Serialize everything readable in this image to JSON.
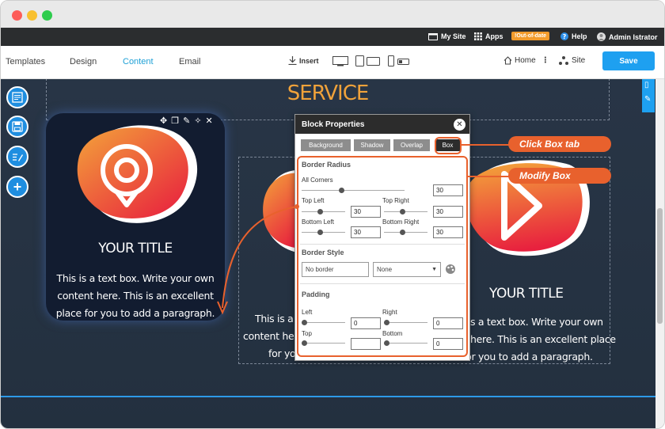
{
  "adminbar": {
    "my_site": "My Site",
    "apps": "Apps",
    "badge": "!Out-of-date",
    "help": "Help",
    "user": "Admin Istrator"
  },
  "toolbar": {
    "tabs": [
      "Templates",
      "Design",
      "Content",
      "Email"
    ],
    "active_tab": "Content",
    "insert": "Insert",
    "home": "Home",
    "site": "Site",
    "save": "Save"
  },
  "page": {
    "service_title": "SERVICE",
    "card_title": "YOUR TITLE",
    "card_text": "This is a text box. Write your own content here. This is an excellent place for you to add a paragraph.",
    "mid_text_lines": [
      "This is a t",
      "content her",
      "for yo"
    ],
    "right_title": "YOUR TITLE",
    "right_text_lines": [
      "s a text box. Write your own",
      "here. This is an excellent place",
      "for you to add a paragraph."
    ]
  },
  "panel": {
    "title": "Block Properties",
    "tabs": [
      "Background",
      "Shadow",
      "Overlap",
      "Box"
    ],
    "active_tab": "Box",
    "border_radius": {
      "title": "Border Radius",
      "all_corners_label": "All Corners",
      "all_corners": "30",
      "top_left_label": "Top Left",
      "top_left": "30",
      "top_right_label": "Top Right",
      "top_right": "30",
      "bottom_left_label": "Bottom Left",
      "bottom_left": "30",
      "bottom_right_label": "Bottom Right",
      "bottom_right": "30"
    },
    "border_style": {
      "title": "Border Style",
      "placeholder": "No border",
      "select": "None"
    },
    "padding": {
      "title": "Padding",
      "left_label": "Left",
      "left": "0",
      "right_label": "Right",
      "right": "0",
      "top_label": "Top",
      "top": "",
      "bottom_label": "Bottom",
      "bottom": "0"
    }
  },
  "callouts": {
    "tab": "Click Box tab",
    "box": "Modify Box"
  },
  "colors": {
    "accent": "#1ea0f0",
    "callout": "#e8612d",
    "service": "#f0a23a"
  }
}
